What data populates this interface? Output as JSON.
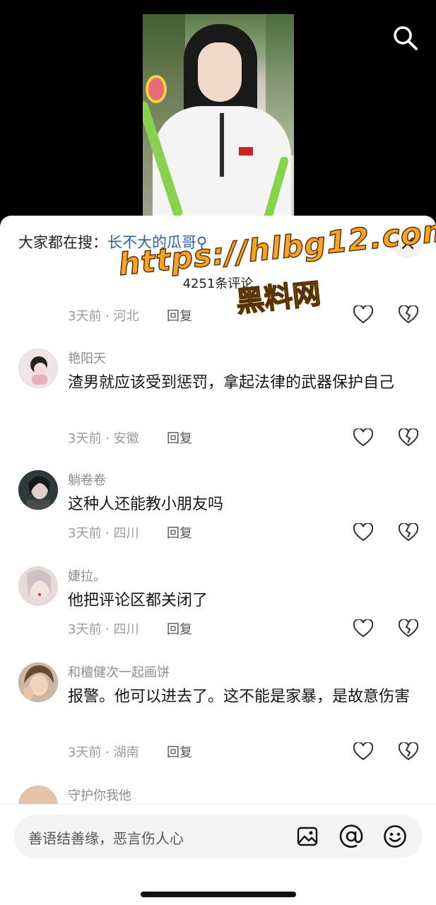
{
  "hot_search": {
    "prefix": "大家都在搜：",
    "term": "长不大的瓜哥",
    "search_glyph": "⚲"
  },
  "comment_count": "4251条评论",
  "watermark": {
    "url": "https://hlbg12.com",
    "name": "黑料网"
  },
  "comments": [
    {
      "user": "",
      "text": "",
      "time": "3天前",
      "location": "河北",
      "reply_label": "回复",
      "avatar_color": "#ffffff"
    },
    {
      "user": "艳阳天",
      "text": "渣男就应该受到惩罚，拿起法律的武器保护自己",
      "time": "3天前",
      "location": "安徽",
      "reply_label": "回复",
      "avatar_color": "#f0e4e6"
    },
    {
      "user": "躺卷卷",
      "text": "这种人还能教小朋友吗",
      "time": "3天前",
      "location": "四川",
      "reply_label": "回复",
      "avatar_color": "#3a3a3a"
    },
    {
      "user": "婕拉。",
      "text": "他把评论区都关闭了",
      "time": "3天前",
      "location": "四川",
      "reply_label": "回复",
      "avatar_color": "#d9c9c9"
    },
    {
      "user": "和檀健次一起画饼",
      "text": "报警。他可以进去了。这不能是家暴，是故意伤害",
      "time": "3天前",
      "location": "湖南",
      "reply_label": "回复",
      "avatar_color": "#7a5a3a"
    },
    {
      "user": "守护你我他",
      "text": "",
      "time": "",
      "location": "",
      "reply_label": "",
      "avatar_color": "#e3c4a8"
    }
  ],
  "input": {
    "placeholder": "善语结善缘，恶言伤人心"
  },
  "colors": {
    "link": "#2f5fa5",
    "watermark": "#f6a32a",
    "meta": "#9a9a9a"
  }
}
